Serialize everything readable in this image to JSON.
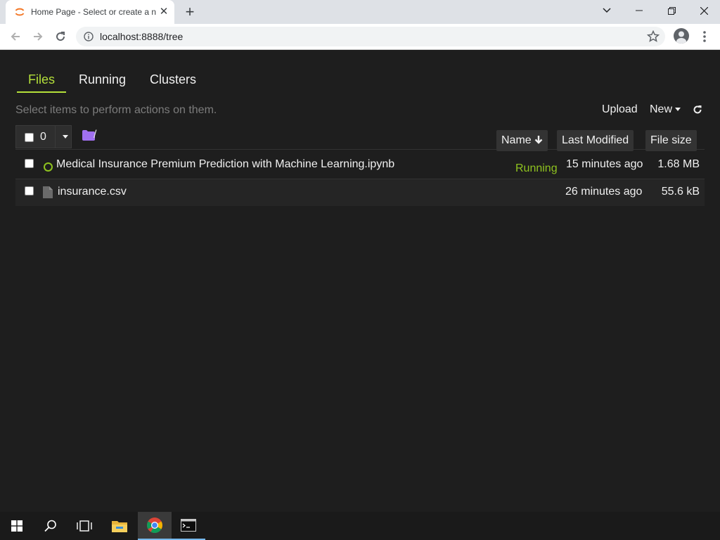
{
  "browser": {
    "tab_title": "Home Page - Select or create a notebook",
    "url": "localhost:8888/tree"
  },
  "jupyter": {
    "tabs": [
      {
        "label": "Files",
        "active": true
      },
      {
        "label": "Running",
        "active": false
      },
      {
        "label": "Clusters",
        "active": false
      }
    ],
    "hint": "Select items to perform actions on them.",
    "upload_label": "Upload",
    "new_label": "New",
    "selected_count": "0",
    "path": "/",
    "columns": {
      "name": "Name",
      "last_modified": "Last Modified",
      "file_size": "File size"
    },
    "files": [
      {
        "name": "Medical Insurance Premium Prediction with Machine Learning.ipynb",
        "type": "notebook",
        "status": "Running",
        "modified": "15 minutes ago",
        "size": "1.68 MB"
      },
      {
        "name": "insurance.csv",
        "type": "file",
        "status": "",
        "modified": "26 minutes ago",
        "size": "55.6 kB"
      }
    ],
    "accent_color": "#b4e03a",
    "running_color": "#8fc31f"
  },
  "taskbar": {
    "items": [
      "start-icon",
      "search-icon",
      "task-view-icon",
      "file-explorer-icon",
      "chrome-icon",
      "terminal-icon"
    ]
  }
}
